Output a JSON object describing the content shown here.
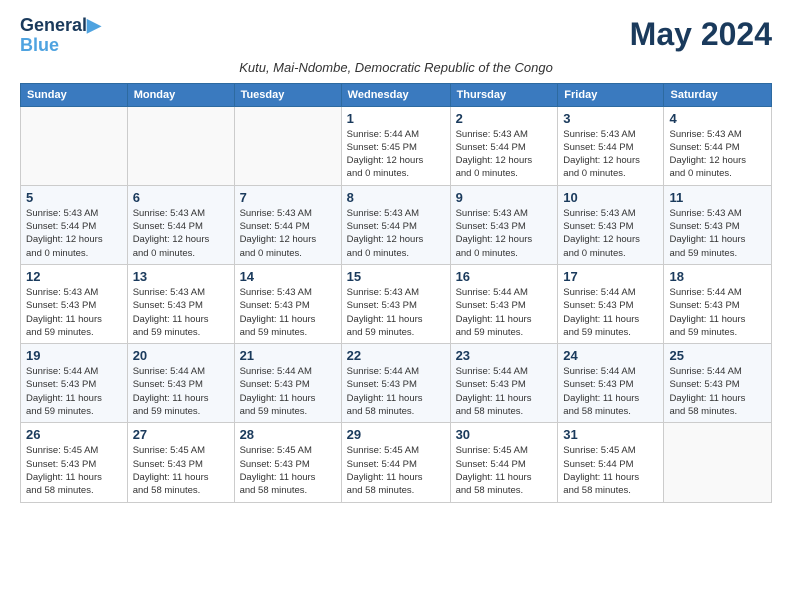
{
  "logo": {
    "line1": "General",
    "line2": "Blue",
    "tagline": "▶"
  },
  "title": "May 2024",
  "subtitle": "Kutu, Mai-Ndombe, Democratic Republic of the Congo",
  "headers": [
    "Sunday",
    "Monday",
    "Tuesday",
    "Wednesday",
    "Thursday",
    "Friday",
    "Saturday"
  ],
  "weeks": [
    [
      {
        "day": "",
        "info": ""
      },
      {
        "day": "",
        "info": ""
      },
      {
        "day": "",
        "info": ""
      },
      {
        "day": "1",
        "info": "Sunrise: 5:44 AM\nSunset: 5:45 PM\nDaylight: 12 hours\nand 0 minutes."
      },
      {
        "day": "2",
        "info": "Sunrise: 5:43 AM\nSunset: 5:44 PM\nDaylight: 12 hours\nand 0 minutes."
      },
      {
        "day": "3",
        "info": "Sunrise: 5:43 AM\nSunset: 5:44 PM\nDaylight: 12 hours\nand 0 minutes."
      },
      {
        "day": "4",
        "info": "Sunrise: 5:43 AM\nSunset: 5:44 PM\nDaylight: 12 hours\nand 0 minutes."
      }
    ],
    [
      {
        "day": "5",
        "info": "Sunrise: 5:43 AM\nSunset: 5:44 PM\nDaylight: 12 hours\nand 0 minutes."
      },
      {
        "day": "6",
        "info": "Sunrise: 5:43 AM\nSunset: 5:44 PM\nDaylight: 12 hours\nand 0 minutes."
      },
      {
        "day": "7",
        "info": "Sunrise: 5:43 AM\nSunset: 5:44 PM\nDaylight: 12 hours\nand 0 minutes."
      },
      {
        "day": "8",
        "info": "Sunrise: 5:43 AM\nSunset: 5:44 PM\nDaylight: 12 hours\nand 0 minutes."
      },
      {
        "day": "9",
        "info": "Sunrise: 5:43 AM\nSunset: 5:43 PM\nDaylight: 12 hours\nand 0 minutes."
      },
      {
        "day": "10",
        "info": "Sunrise: 5:43 AM\nSunset: 5:43 PM\nDaylight: 12 hours\nand 0 minutes."
      },
      {
        "day": "11",
        "info": "Sunrise: 5:43 AM\nSunset: 5:43 PM\nDaylight: 11 hours\nand 59 minutes."
      }
    ],
    [
      {
        "day": "12",
        "info": "Sunrise: 5:43 AM\nSunset: 5:43 PM\nDaylight: 11 hours\nand 59 minutes."
      },
      {
        "day": "13",
        "info": "Sunrise: 5:43 AM\nSunset: 5:43 PM\nDaylight: 11 hours\nand 59 minutes."
      },
      {
        "day": "14",
        "info": "Sunrise: 5:43 AM\nSunset: 5:43 PM\nDaylight: 11 hours\nand 59 minutes."
      },
      {
        "day": "15",
        "info": "Sunrise: 5:43 AM\nSunset: 5:43 PM\nDaylight: 11 hours\nand 59 minutes."
      },
      {
        "day": "16",
        "info": "Sunrise: 5:44 AM\nSunset: 5:43 PM\nDaylight: 11 hours\nand 59 minutes."
      },
      {
        "day": "17",
        "info": "Sunrise: 5:44 AM\nSunset: 5:43 PM\nDaylight: 11 hours\nand 59 minutes."
      },
      {
        "day": "18",
        "info": "Sunrise: 5:44 AM\nSunset: 5:43 PM\nDaylight: 11 hours\nand 59 minutes."
      }
    ],
    [
      {
        "day": "19",
        "info": "Sunrise: 5:44 AM\nSunset: 5:43 PM\nDaylight: 11 hours\nand 59 minutes."
      },
      {
        "day": "20",
        "info": "Sunrise: 5:44 AM\nSunset: 5:43 PM\nDaylight: 11 hours\nand 59 minutes."
      },
      {
        "day": "21",
        "info": "Sunrise: 5:44 AM\nSunset: 5:43 PM\nDaylight: 11 hours\nand 59 minutes."
      },
      {
        "day": "22",
        "info": "Sunrise: 5:44 AM\nSunset: 5:43 PM\nDaylight: 11 hours\nand 58 minutes."
      },
      {
        "day": "23",
        "info": "Sunrise: 5:44 AM\nSunset: 5:43 PM\nDaylight: 11 hours\nand 58 minutes."
      },
      {
        "day": "24",
        "info": "Sunrise: 5:44 AM\nSunset: 5:43 PM\nDaylight: 11 hours\nand 58 minutes."
      },
      {
        "day": "25",
        "info": "Sunrise: 5:44 AM\nSunset: 5:43 PM\nDaylight: 11 hours\nand 58 minutes."
      }
    ],
    [
      {
        "day": "26",
        "info": "Sunrise: 5:45 AM\nSunset: 5:43 PM\nDaylight: 11 hours\nand 58 minutes."
      },
      {
        "day": "27",
        "info": "Sunrise: 5:45 AM\nSunset: 5:43 PM\nDaylight: 11 hours\nand 58 minutes."
      },
      {
        "day": "28",
        "info": "Sunrise: 5:45 AM\nSunset: 5:43 PM\nDaylight: 11 hours\nand 58 minutes."
      },
      {
        "day": "29",
        "info": "Sunrise: 5:45 AM\nSunset: 5:44 PM\nDaylight: 11 hours\nand 58 minutes."
      },
      {
        "day": "30",
        "info": "Sunrise: 5:45 AM\nSunset: 5:44 PM\nDaylight: 11 hours\nand 58 minutes."
      },
      {
        "day": "31",
        "info": "Sunrise: 5:45 AM\nSunset: 5:44 PM\nDaylight: 11 hours\nand 58 minutes."
      },
      {
        "day": "",
        "info": ""
      }
    ]
  ]
}
